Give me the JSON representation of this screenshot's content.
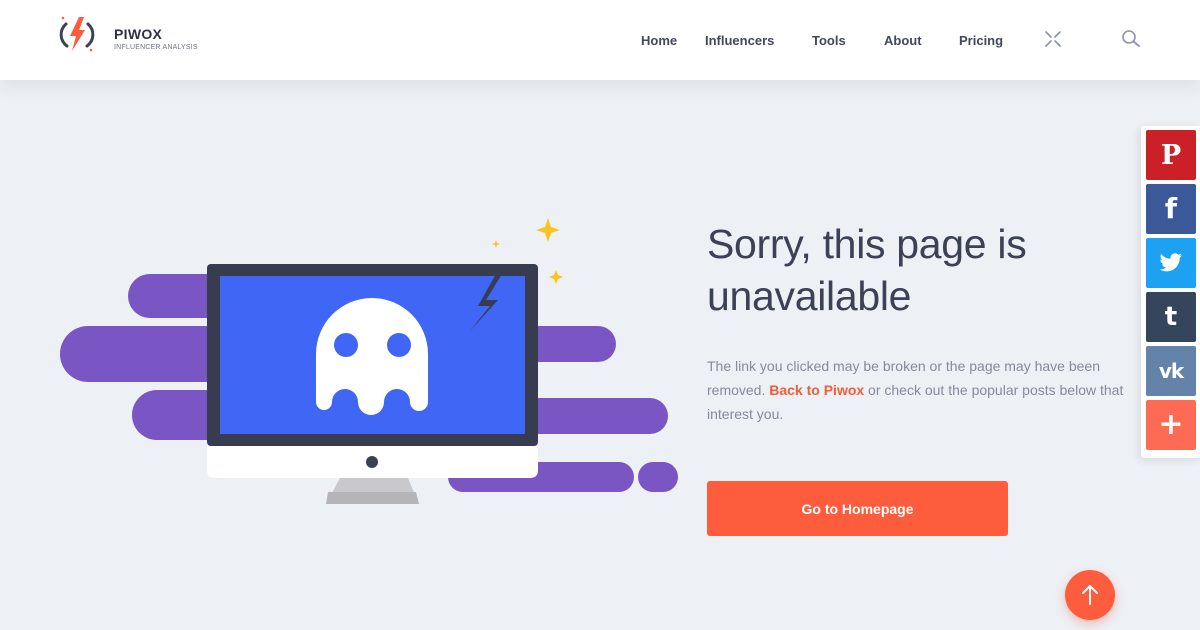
{
  "brand": {
    "name": "PIWOX",
    "tagline": "INFLUENCER ANALYSIS",
    "accent_color": "#fd5d3c"
  },
  "nav": {
    "items": [
      {
        "label": "Home"
      },
      {
        "label": "Influencers"
      },
      {
        "label": "Tools"
      },
      {
        "label": "About"
      },
      {
        "label": "Pricing"
      }
    ],
    "icons": [
      "close-icon",
      "search-icon"
    ]
  },
  "error_page": {
    "illustration": "ghost-monitor-icon",
    "title": "Sorry, this page is unavailable",
    "desc_before": "The link you clicked may be broken or the page may have been removed. ",
    "link_label": "Back to Piwox",
    "desc_after": " or check out the popular posts below that interest you.",
    "button_label": "Go to Homepage"
  },
  "social": [
    {
      "name": "pinterest",
      "icon": "pinterest-icon",
      "glyph": "P",
      "color": "#cb2027"
    },
    {
      "name": "facebook",
      "icon": "facebook-icon",
      "glyph": "f",
      "color": "#3b5998"
    },
    {
      "name": "twitter",
      "icon": "twitter-icon",
      "glyph": "",
      "color": "#1da1f2"
    },
    {
      "name": "tumblr",
      "icon": "tumblr-icon",
      "glyph": "t",
      "color": "#35465c"
    },
    {
      "name": "vk",
      "icon": "vk-icon",
      "glyph": "vk",
      "color": "#6383a8"
    },
    {
      "name": "more",
      "icon": "plus-icon",
      "glyph": "+",
      "color": "#fd6b54"
    }
  ],
  "scroll_top": {
    "icon": "arrow-up-icon"
  }
}
